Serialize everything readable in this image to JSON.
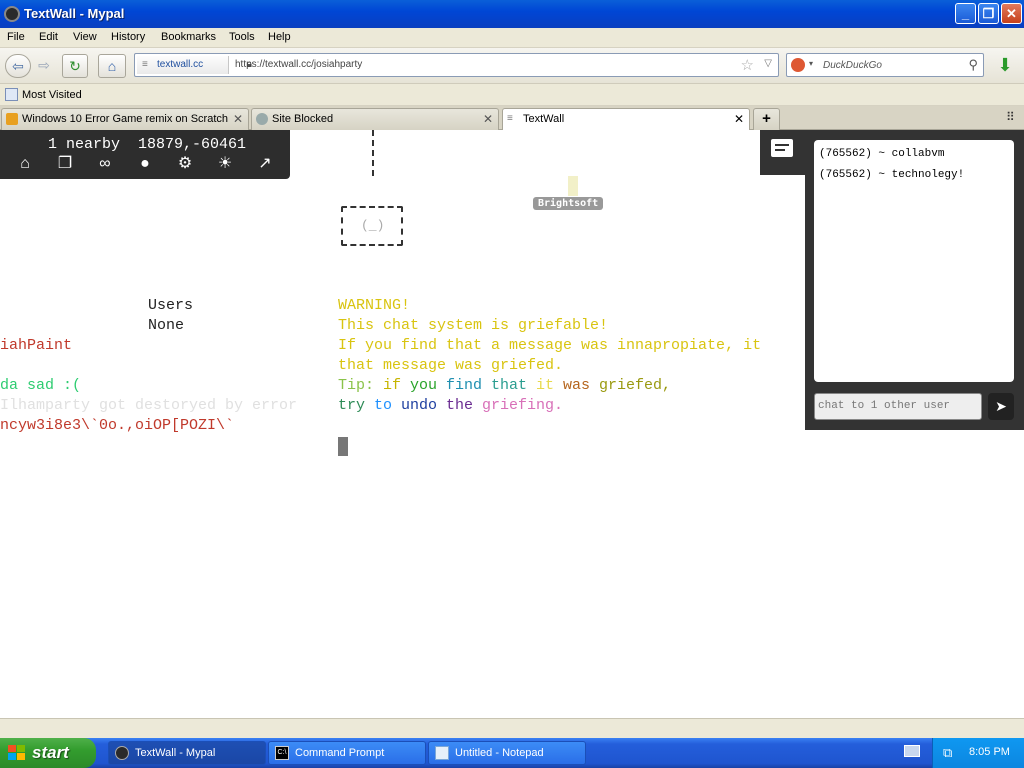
{
  "window": {
    "title": "TextWall - Mypal"
  },
  "menu": [
    "File",
    "Edit",
    "View",
    "History",
    "Bookmarks",
    "Tools",
    "Help"
  ],
  "nav": {
    "site_identity": "textwall.cc",
    "url": "https://textwall.cc/josiahparty",
    "search_placeholder": "DuckDuckGo"
  },
  "bookmarks": {
    "most_visited": "Most Visited"
  },
  "tabs": [
    {
      "label": "Windows 10 Error Game remix on Scratch",
      "active": false
    },
    {
      "label": "Site Blocked",
      "active": false
    },
    {
      "label": "TextWall",
      "active": true
    }
  ],
  "toolpanel": {
    "status": "1 nearby  18879,-60461",
    "icons": [
      "home-icon",
      "copy-icon",
      "link-icon",
      "palette-icon",
      "gear-icon",
      "brightness-icon",
      "arrow-up-right-icon"
    ]
  },
  "wall": {
    "brightsoft_label": "Brightsoft",
    "box_face": "(_)",
    "users_header": "Users",
    "users_value": "None",
    "left_lines": [
      {
        "text": "iahPaint",
        "color": "#c0392b"
      },
      {
        "text": "da sad :(",
        "color": "#2ecc71"
      },
      {
        "text": "Ilhamparty got destoryed by error",
        "color": "#e4e4e4"
      },
      {
        "text": "ncyw3i8e3\\`0o.,oiOP[POZI\\`",
        "color": "#c0392b"
      }
    ],
    "warning_lines": [
      "WARNING!",
      "This chat system is griefable!",
      "If you find that a message was innapropiate, it",
      "that message was griefed."
    ],
    "warning_color": "#d9c410",
    "tip_words": [
      {
        "text": "Tip:",
        "color": "#8bc34a"
      },
      {
        "text": "if",
        "color": "#c6b500"
      },
      {
        "text": "you",
        "color": "#2aa32a"
      },
      {
        "text": "find",
        "color": "#1f8fb0"
      },
      {
        "text": "that",
        "color": "#2a9d8f"
      },
      {
        "text": "it",
        "color": "#e8d94c"
      },
      {
        "text": "was",
        "color": "#b5651d"
      },
      {
        "text": "griefed,",
        "color": "#9a9a10"
      }
    ],
    "undo_words": [
      {
        "text": "try",
        "color": "#2e8b57"
      },
      {
        "text": "to",
        "color": "#1e90ff"
      },
      {
        "text": "undo",
        "color": "#1e3fa0"
      },
      {
        "text": "the",
        "color": "#6a2c91"
      },
      {
        "text": "griefing.",
        "color": "#d870b8"
      }
    ]
  },
  "chat": {
    "messages": [
      "(765562) ~ collabvm",
      "(765562) ~ technolegy!"
    ],
    "input_placeholder": "chat to 1 other user"
  },
  "taskbar": {
    "start": "start",
    "tasks": [
      {
        "label": "TextWall - Mypal",
        "active": true
      },
      {
        "label": "Command Prompt",
        "active": false
      },
      {
        "label": "Untitled - Notepad",
        "active": false
      }
    ],
    "clock": "8:05 PM"
  }
}
